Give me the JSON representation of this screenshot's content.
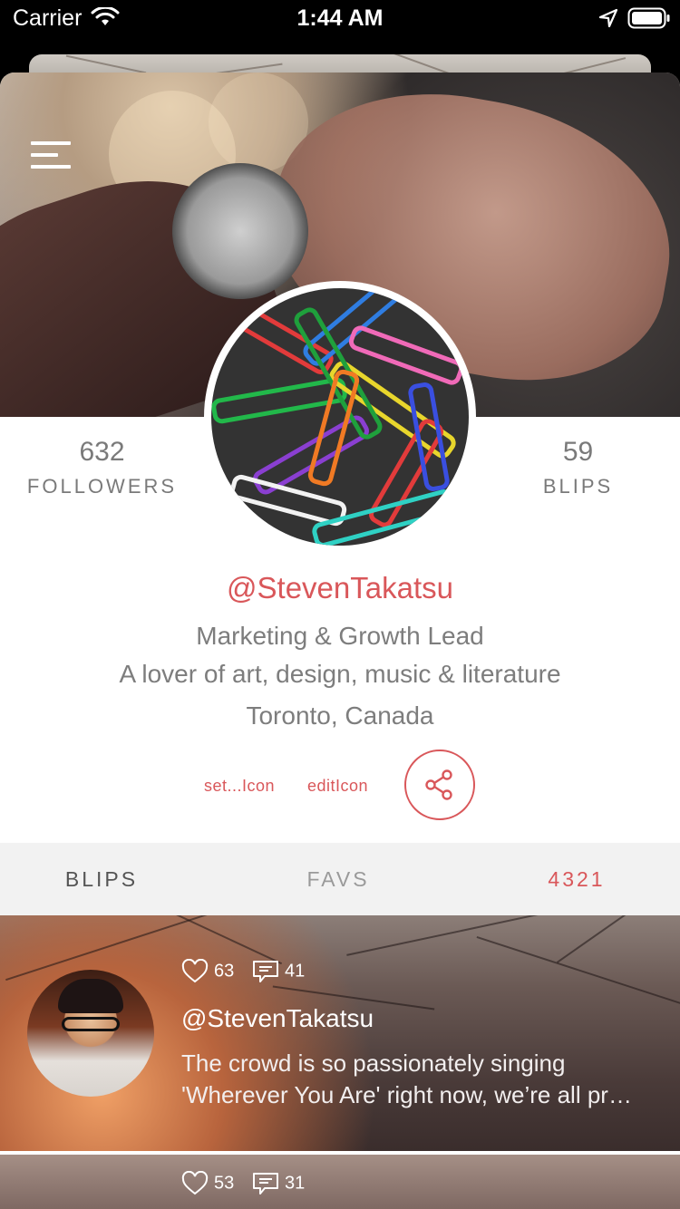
{
  "status_bar": {
    "carrier": "Carrier",
    "time": "1:44 AM",
    "icons": [
      "wifi-icon",
      "location-arrow-icon",
      "battery-icon"
    ]
  },
  "header": {
    "menu_icon": "hamburger-menu-icon"
  },
  "profile": {
    "followers_count": "632",
    "followers_label": "FOLLOWERS",
    "blips_count": "59",
    "blips_label": "BLIPS",
    "handle": "@StevenTakatsu",
    "role": "Marketing & Growth Lead",
    "bio": "A lover of art, design, music & literature",
    "location": "Toronto, Canada"
  },
  "actions": {
    "settings_label": "set...Icon",
    "edit_label": "editIcon",
    "share_icon": "share-icon"
  },
  "tabs": [
    {
      "label": "BLIPS"
    },
    {
      "label": "FAVS"
    },
    {
      "label": "4321"
    }
  ],
  "feed": [
    {
      "likes": "63",
      "comments": "41",
      "handle": "@StevenTakatsu",
      "text_line1": "The crowd is so passionately singing",
      "text_line2": "'Wherever You Are' right now, we’re all pr…"
    },
    {
      "likes": "53",
      "comments": "31"
    }
  ],
  "colors": {
    "accent": "#d9575a",
    "muted_text": "#7a7a7a",
    "tab_bar_bg": "#f2f2f2"
  }
}
